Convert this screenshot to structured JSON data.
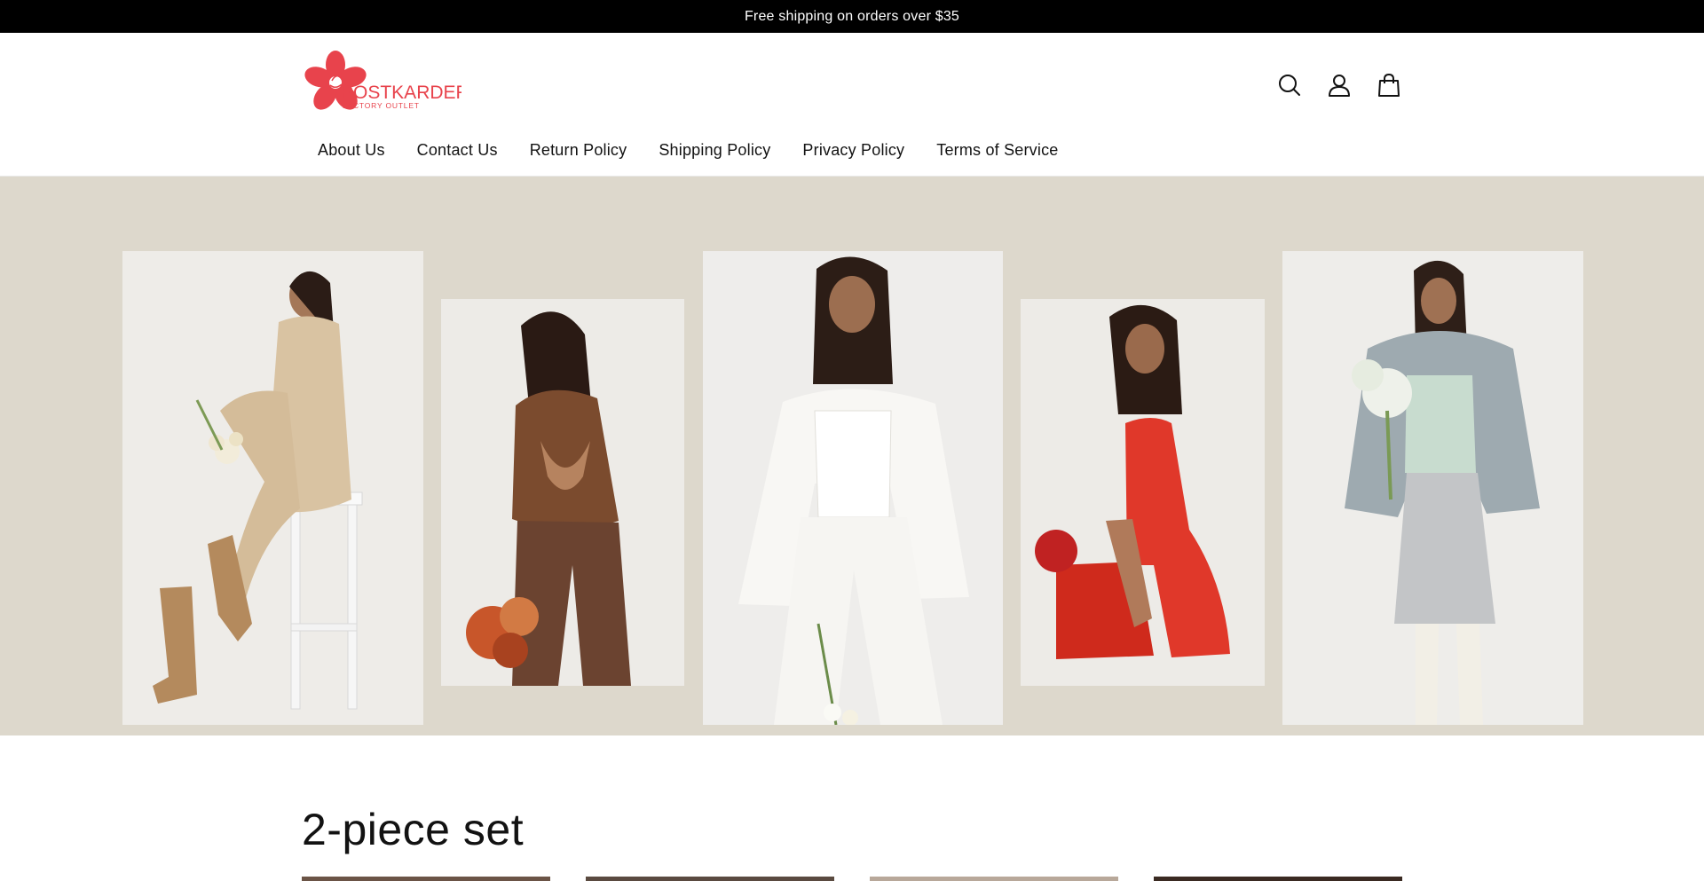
{
  "announcement": {
    "text": "Free shipping on orders over $35"
  },
  "brand": {
    "name": "POSTKARDER",
    "tagline": "FACTORY OUTLET",
    "accent": "#e8434c"
  },
  "header": {
    "icons": [
      "search-icon",
      "account-icon",
      "cart-icon"
    ]
  },
  "nav": {
    "items": [
      {
        "label": "About Us"
      },
      {
        "label": "Contact Us"
      },
      {
        "label": "Return Policy"
      },
      {
        "label": "Shipping Policy"
      },
      {
        "label": "Privacy Policy"
      },
      {
        "label": "Terms of Service"
      }
    ]
  },
  "hero": {
    "background": "#ddd8cc",
    "panels": [
      {
        "outfit": "beige knit dress",
        "color": "#d8c4a4"
      },
      {
        "outfit": "brown sweater and leather pants",
        "color": "#7a4a2c"
      },
      {
        "outfit": "white corset and blazer",
        "color": "#f3f1ec"
      },
      {
        "outfit": "red satin dress",
        "color": "#e23a2a"
      },
      {
        "outfit": "grey faux fur coat",
        "color": "#9eaab0"
      }
    ]
  },
  "collection": {
    "title": "2-piece set"
  },
  "products": [
    {
      "tone": "#6b5446"
    },
    {
      "tone": "#5a4a40"
    },
    {
      "tone": "#b8a89a"
    },
    {
      "tone": "#3a2a22"
    }
  ]
}
